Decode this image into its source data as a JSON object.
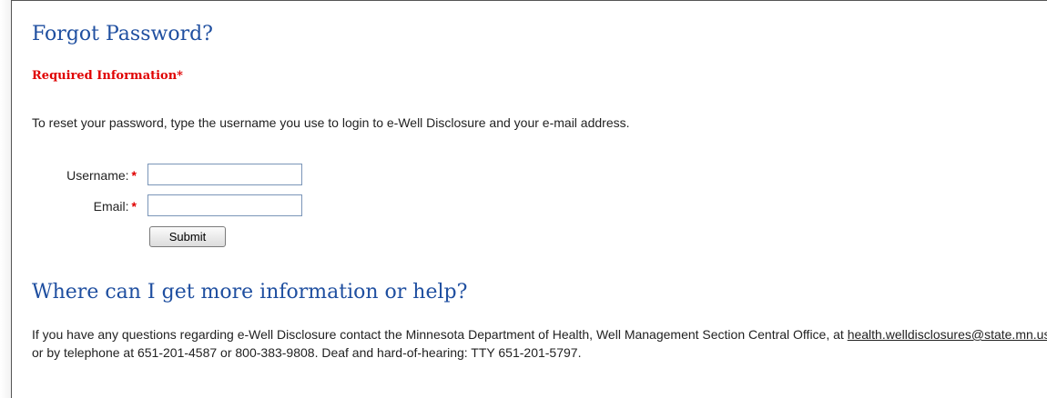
{
  "page_title": "Forgot Password?",
  "required_note": "Required Information*",
  "intro_text": "To reset your password, type the username you use to login to e-Well Disclosure and your e-mail address.",
  "form": {
    "username_label": "Username:",
    "email_label": "Email:",
    "required_marker": "*",
    "username_value": "",
    "email_value": "",
    "submit_label": "Submit"
  },
  "help": {
    "heading": "Where can I get more information or help?",
    "text_before_link": "If you have any questions regarding e-Well Disclosure contact the Minnesota Department of Health, Well Management Section Central Office, at ",
    "email_link": "health.welldisclosures@state.mn.us",
    "text_after_link": " or by telephone at 651-201-4587 or 800-383-9808. Deaf and hard-of-hearing: TTY 651-201-5797."
  }
}
